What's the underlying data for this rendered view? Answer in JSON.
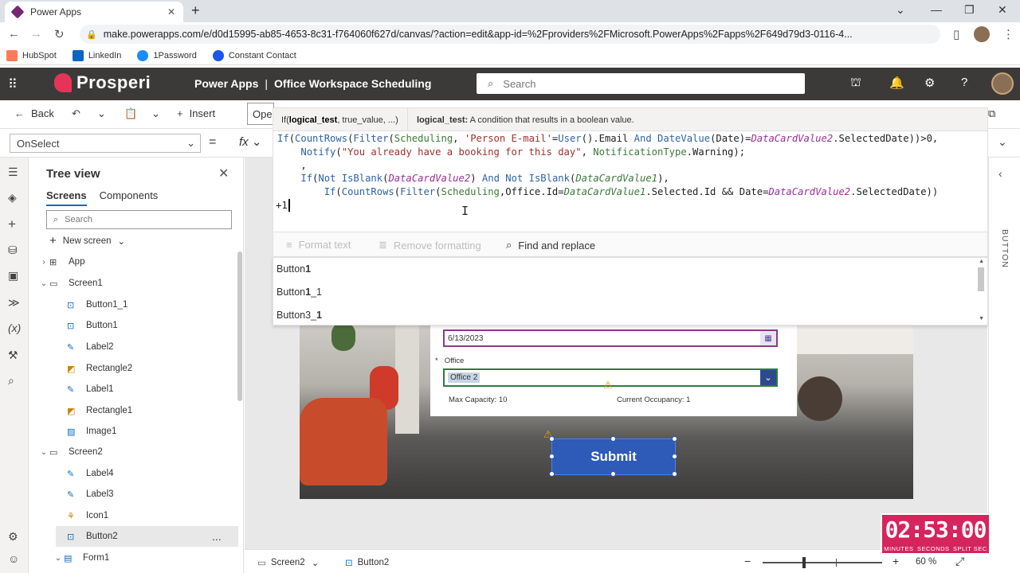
{
  "browser": {
    "tab_title": "Power Apps",
    "url": "make.powerapps.com/e/d0d15995-ab85-4653-8c31-f764060f627d/canvas/?action=edit&app-id=%2Fproviders%2FMicrosoft.PowerApps%2Fapps%2F649d79d3-0116-4...",
    "bookmarks": [
      "HubSpot",
      "LinkedIn",
      "1Password",
      "Constant Contact"
    ]
  },
  "header": {
    "brand": "Prosperi",
    "product": "Power Apps",
    "separator": "|",
    "app_name": "Office Workspace Scheduling",
    "search_placeholder": "Search"
  },
  "commandbar": {
    "back": "Back",
    "insert": "Insert",
    "partial": "Ope"
  },
  "formulabar": {
    "property": "OnSelect",
    "equals": "=",
    "fx": "fx"
  },
  "fxhint": {
    "fn": "If(",
    "param": "logical_test",
    "rest": ", true_value, ...)",
    "param_label": "logical_test:",
    "description": "A condition that results in a boolean value."
  },
  "code": {
    "line1": "If(CountRows(Filter(Scheduling, 'Person E-mail'=User().Email And DateValue(Date)=DataCardValue2.SelectedDate))>0,",
    "line2": "    Notify(\"You already have a booking for this day\", NotificationType.Warning);",
    "line3": "    ,",
    "line4": "    If(Not IsBlank(DataCardValue2) And Not IsBlank(DataCardValue1),",
    "line5": "        If(CountRows(Filter(Scheduling,Office.Id=DataCardValue1.Selected.Id && Date=DataCardValue2.SelectedDate))",
    "line6": "+1"
  },
  "format_toolbar": {
    "format_text": "Format text",
    "remove_formatting": "Remove formatting",
    "find_replace": "Find and replace"
  },
  "suggestions": [
    "Button1",
    "Button1_1",
    "Button3_1"
  ],
  "treeview": {
    "title": "Tree view",
    "tabs": [
      "Screens",
      "Components"
    ],
    "search_placeholder": "Search",
    "new_screen": "New screen",
    "items": [
      {
        "label": "App",
        "level": 0
      },
      {
        "label": "Screen1",
        "level": 0
      },
      {
        "label": "Button1_1",
        "level": 1
      },
      {
        "label": "Button1",
        "level": 1
      },
      {
        "label": "Label2",
        "level": 1
      },
      {
        "label": "Rectangle2",
        "level": 1
      },
      {
        "label": "Label1",
        "level": 1
      },
      {
        "label": "Rectangle1",
        "level": 1
      },
      {
        "label": "Image1",
        "level": 1
      },
      {
        "label": "Screen2",
        "level": 0
      },
      {
        "label": "Label4",
        "level": 1
      },
      {
        "label": "Label3",
        "level": 1
      },
      {
        "label": "Icon1",
        "level": 1
      },
      {
        "label": "Button2",
        "level": 1,
        "selected": true
      },
      {
        "label": "Form1",
        "level": 1
      }
    ],
    "more": "..."
  },
  "canvas": {
    "date_value": "6/13/2023",
    "office_label": "Office",
    "required_star": "*",
    "office_value": "Office 2",
    "max_capacity": "Max Capacity: 10",
    "current_occupancy": "Current Occupancy: 1",
    "submit": "Submit"
  },
  "rightpanel": {
    "label": "BUTTON"
  },
  "statusbar": {
    "screen": "Screen2",
    "control": "Button2",
    "zoom": "60  %"
  },
  "timer": {
    "time": "02:53:00",
    "labels": [
      "MINUTES",
      "SECONDS",
      "SPLIT SEC"
    ]
  },
  "colors": {
    "header_bg": "#3b3a39",
    "brand_accent": "#e63459",
    "submit_bg": "#2e5ab8",
    "timer_bg": "#d6245c"
  }
}
